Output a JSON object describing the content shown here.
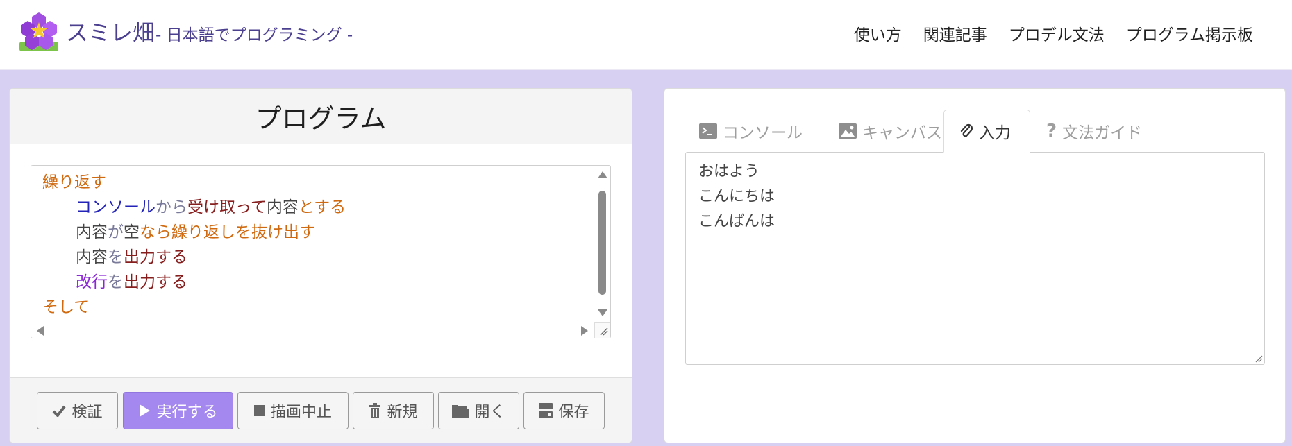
{
  "site": {
    "brand": "スミレ畑",
    "tagline": "- 日本語でプログラミング -",
    "nav": [
      "使い方",
      "関連記事",
      "プロデル文法",
      "プログラム掲示板"
    ]
  },
  "program_panel": {
    "title": "プログラム",
    "code_lines": [
      {
        "indent": 0,
        "tokens": [
          {
            "text": "繰り返す",
            "kind": "keyword"
          }
        ]
      },
      {
        "indent": 1,
        "tokens": [
          {
            "text": "コンソール",
            "kind": "object"
          },
          {
            "text": "から",
            "kind": "particle"
          },
          {
            "text": "受け取って",
            "kind": "function"
          },
          {
            "text": "内容",
            "kind": "variable"
          },
          {
            "text": "とする",
            "kind": "keyword"
          }
        ]
      },
      {
        "indent": 1,
        "tokens": [
          {
            "text": "内容",
            "kind": "variable"
          },
          {
            "text": "が",
            "kind": "particle"
          },
          {
            "text": "空",
            "kind": "variable"
          },
          {
            "text": "なら繰り返しを抜け出す",
            "kind": "keyword"
          }
        ]
      },
      {
        "indent": 1,
        "tokens": [
          {
            "text": "内容",
            "kind": "variable"
          },
          {
            "text": "を",
            "kind": "particle"
          },
          {
            "text": "出力する",
            "kind": "function"
          }
        ]
      },
      {
        "indent": 1,
        "tokens": [
          {
            "text": "改行",
            "kind": "constant"
          },
          {
            "text": "を",
            "kind": "particle"
          },
          {
            "text": "出力する",
            "kind": "function"
          }
        ]
      },
      {
        "indent": 0,
        "tokens": [
          {
            "text": "そして",
            "kind": "keyword"
          }
        ]
      }
    ],
    "buttons": {
      "verify": "検証",
      "run": "実行する",
      "stop": "描画中止",
      "new": "新規",
      "open": "開く",
      "save": "保存"
    }
  },
  "right_panel": {
    "tabs": {
      "console": "コンソール",
      "canvas": "キャンバス",
      "input": "入力",
      "guide": "文法ガイド"
    },
    "active_tab": "入力",
    "input_lines": [
      "おはよう",
      "こんにちは",
      "こんばんは"
    ]
  },
  "colors": {
    "accent": "#a488ef",
    "background": "#d8d0f3",
    "keyword": "#d06a10",
    "object": "#2323b8",
    "function": "#861e1e",
    "constant": "#8a28d4",
    "particle": "#7a7a9a"
  }
}
